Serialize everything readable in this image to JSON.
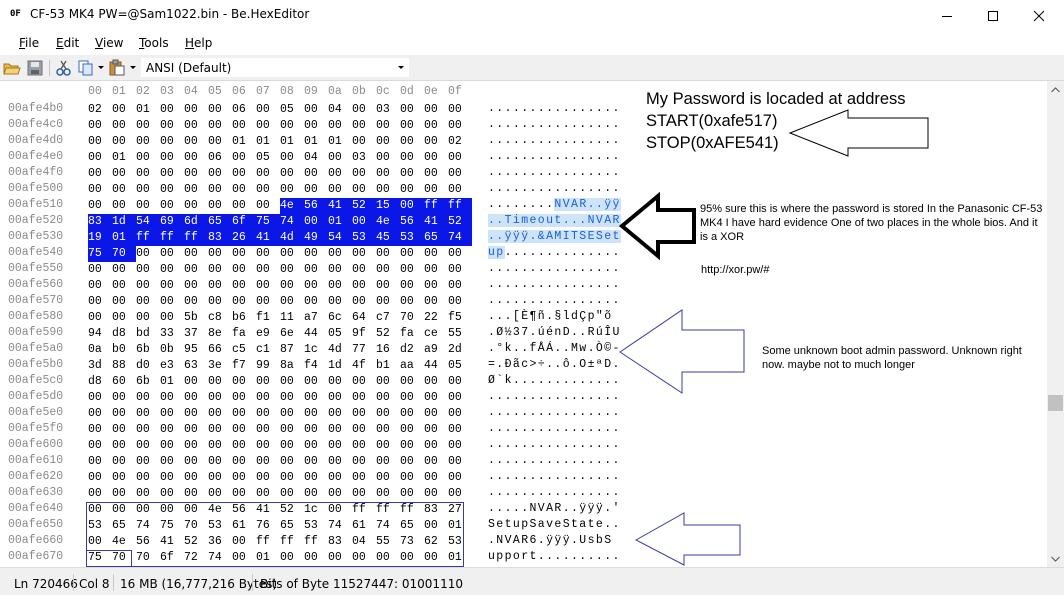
{
  "window": {
    "icon_text": "0F",
    "title": "CF-53 MK4 PW=@Sam1022.bin - Be.HexEditor"
  },
  "menu": [
    {
      "label": "File",
      "key": "F",
      "rest": "ile"
    },
    {
      "label": "Edit",
      "key": "E",
      "rest": "dit"
    },
    {
      "label": "View",
      "key": "V",
      "rest": "iew"
    },
    {
      "label": "Tools",
      "key": "T",
      "rest": "ools"
    },
    {
      "label": "Help",
      "key": "H",
      "rest": "elp"
    }
  ],
  "toolbar": {
    "encoding": "ANSI (Default)"
  },
  "hex": {
    "column_headers": [
      "00",
      "01",
      "02",
      "03",
      "04",
      "05",
      "06",
      "07",
      "08",
      "09",
      "0a",
      "0b",
      "0c",
      "0d",
      "0e",
      "0f"
    ],
    "rows": [
      {
        "offset": "00afe4b0",
        "bytes": [
          "02",
          "00",
          "01",
          "00",
          "00",
          "00",
          "06",
          "00",
          "05",
          "00",
          "04",
          "00",
          "03",
          "00",
          "00",
          "00"
        ],
        "text": "................"
      },
      {
        "offset": "00afe4c0",
        "bytes": [
          "00",
          "00",
          "00",
          "00",
          "00",
          "00",
          "00",
          "00",
          "00",
          "00",
          "00",
          "00",
          "00",
          "00",
          "00",
          "00"
        ],
        "text": "................"
      },
      {
        "offset": "00afe4d0",
        "bytes": [
          "00",
          "00",
          "00",
          "00",
          "00",
          "00",
          "01",
          "01",
          "01",
          "01",
          "01",
          "00",
          "00",
          "00",
          "00",
          "02"
        ],
        "text": "................"
      },
      {
        "offset": "00afe4e0",
        "bytes": [
          "00",
          "01",
          "00",
          "00",
          "00",
          "06",
          "00",
          "05",
          "00",
          "04",
          "00",
          "03",
          "00",
          "00",
          "00",
          "00"
        ],
        "text": "................"
      },
      {
        "offset": "00afe4f0",
        "bytes": [
          "00",
          "00",
          "00",
          "00",
          "00",
          "00",
          "00",
          "00",
          "00",
          "00",
          "00",
          "00",
          "00",
          "00",
          "00",
          "00"
        ],
        "text": "................"
      },
      {
        "offset": "00afe500",
        "bytes": [
          "00",
          "00",
          "00",
          "00",
          "00",
          "00",
          "00",
          "00",
          "00",
          "00",
          "00",
          "00",
          "00",
          "00",
          "00",
          "00"
        ],
        "text": "................"
      },
      {
        "offset": "00afe510",
        "bytes": [
          "00",
          "00",
          "00",
          "00",
          "00",
          "00",
          "00",
          "00",
          "4e",
          "56",
          "41",
          "52",
          "15",
          "00",
          "ff",
          "ff"
        ],
        "text": "........",
        "text_sel": "NVAR..ÿÿ",
        "sel_from": 8
      },
      {
        "offset": "00afe520",
        "bytes": [
          "83",
          "1d",
          "54",
          "69",
          "6d",
          "65",
          "6f",
          "75",
          "74",
          "00",
          "01",
          "00",
          "4e",
          "56",
          "41",
          "52"
        ],
        "text": "",
        "text_sel": "..Timeout...NVAR",
        "sel_from": 0
      },
      {
        "offset": "00afe530",
        "bytes": [
          "19",
          "01",
          "ff",
          "ff",
          "ff",
          "83",
          "26",
          "41",
          "4d",
          "49",
          "54",
          "53",
          "45",
          "53",
          "65",
          "74"
        ],
        "text": "",
        "text_sel": "..ÿÿÿ.&AMITSESet",
        "sel_from": 0
      },
      {
        "offset": "00afe540",
        "bytes": [
          "75",
          "70",
          "00",
          "00",
          "00",
          "00",
          "00",
          "00",
          "00",
          "00",
          "00",
          "00",
          "00",
          "00",
          "00",
          "00"
        ],
        "text_pre": "up",
        "text": "..............",
        "sel_to": 2
      },
      {
        "offset": "00afe550",
        "bytes": [
          "00",
          "00",
          "00",
          "00",
          "00",
          "00",
          "00",
          "00",
          "00",
          "00",
          "00",
          "00",
          "00",
          "00",
          "00",
          "00"
        ],
        "text": "................"
      },
      {
        "offset": "00afe560",
        "bytes": [
          "00",
          "00",
          "00",
          "00",
          "00",
          "00",
          "00",
          "00",
          "00",
          "00",
          "00",
          "00",
          "00",
          "00",
          "00",
          "00"
        ],
        "text": "................"
      },
      {
        "offset": "00afe570",
        "bytes": [
          "00",
          "00",
          "00",
          "00",
          "00",
          "00",
          "00",
          "00",
          "00",
          "00",
          "00",
          "00",
          "00",
          "00",
          "00",
          "00"
        ],
        "text": "................"
      },
      {
        "offset": "00afe580",
        "bytes": [
          "00",
          "00",
          "00",
          "00",
          "5b",
          "c8",
          "b6",
          "f1",
          "11",
          "a7",
          "6c",
          "64",
          "c7",
          "70",
          "22",
          "f5"
        ],
        "text": "...[È¶ñ.§ldÇp\"õ"
      },
      {
        "offset": "00afe590",
        "bytes": [
          "94",
          "d8",
          "bd",
          "33",
          "37",
          "8e",
          "fa",
          "e9",
          "6e",
          "44",
          "05",
          "9f",
          "52",
          "fa",
          "ce",
          "55"
        ],
        "text": ".Ø½37.úénD..RúÎU"
      },
      {
        "offset": "00afe5a0",
        "bytes": [
          "0a",
          "b0",
          "6b",
          "0b",
          "95",
          "66",
          "c5",
          "c1",
          "87",
          "1c",
          "4d",
          "77",
          "16",
          "d2",
          "a9",
          "2d"
        ],
        "text": ".°k..fÅÁ..Mw.Ò©-"
      },
      {
        "offset": "00afe5b0",
        "bytes": [
          "3d",
          "88",
          "d0",
          "e3",
          "63",
          "3e",
          "f7",
          "99",
          "8a",
          "f4",
          "1d",
          "4f",
          "b1",
          "aa",
          "44",
          "05"
        ],
        "text": "=.Ðãc>÷..ô.O±ªD."
      },
      {
        "offset": "00afe5c0",
        "bytes": [
          "d8",
          "60",
          "6b",
          "01",
          "00",
          "00",
          "00",
          "00",
          "00",
          "00",
          "00",
          "00",
          "00",
          "00",
          "00",
          "00"
        ],
        "text": "Ø`k............."
      },
      {
        "offset": "00afe5d0",
        "bytes": [
          "00",
          "00",
          "00",
          "00",
          "00",
          "00",
          "00",
          "00",
          "00",
          "00",
          "00",
          "00",
          "00",
          "00",
          "00",
          "00"
        ],
        "text": "................"
      },
      {
        "offset": "00afe5e0",
        "bytes": [
          "00",
          "00",
          "00",
          "00",
          "00",
          "00",
          "00",
          "00",
          "00",
          "00",
          "00",
          "00",
          "00",
          "00",
          "00",
          "00"
        ],
        "text": "................"
      },
      {
        "offset": "00afe5f0",
        "bytes": [
          "00",
          "00",
          "00",
          "00",
          "00",
          "00",
          "00",
          "00",
          "00",
          "00",
          "00",
          "00",
          "00",
          "00",
          "00",
          "00"
        ],
        "text": "................"
      },
      {
        "offset": "00afe600",
        "bytes": [
          "00",
          "00",
          "00",
          "00",
          "00",
          "00",
          "00",
          "00",
          "00",
          "00",
          "00",
          "00",
          "00",
          "00",
          "00",
          "00"
        ],
        "text": "................"
      },
      {
        "offset": "00afe610",
        "bytes": [
          "00",
          "00",
          "00",
          "00",
          "00",
          "00",
          "00",
          "00",
          "00",
          "00",
          "00",
          "00",
          "00",
          "00",
          "00",
          "00"
        ],
        "text": "................"
      },
      {
        "offset": "00afe620",
        "bytes": [
          "00",
          "00",
          "00",
          "00",
          "00",
          "00",
          "00",
          "00",
          "00",
          "00",
          "00",
          "00",
          "00",
          "00",
          "00",
          "00"
        ],
        "text": "................"
      },
      {
        "offset": "00afe630",
        "bytes": [
          "00",
          "00",
          "00",
          "00",
          "00",
          "00",
          "00",
          "00",
          "00",
          "00",
          "00",
          "00",
          "00",
          "00",
          "00",
          "00"
        ],
        "text": "................"
      },
      {
        "offset": "00afe640",
        "bytes": [
          "00",
          "00",
          "00",
          "00",
          "00",
          "4e",
          "56",
          "41",
          "52",
          "1c",
          "00",
          "ff",
          "ff",
          "ff",
          "83",
          "27"
        ],
        "text": ".....NVAR..ÿÿÿ.'"
      },
      {
        "offset": "00afe650",
        "bytes": [
          "53",
          "65",
          "74",
          "75",
          "70",
          "53",
          "61",
          "76",
          "65",
          "53",
          "74",
          "61",
          "74",
          "65",
          "00",
          "01"
        ],
        "text": "SetupSaveState.."
      },
      {
        "offset": "00afe660",
        "bytes": [
          "00",
          "4e",
          "56",
          "41",
          "52",
          "36",
          "00",
          "ff",
          "ff",
          "ff",
          "83",
          "04",
          "55",
          "73",
          "62",
          "53"
        ],
        "text": ".NVAR6.ÿÿÿ.UsbS"
      },
      {
        "offset": "00afe670",
        "bytes": [
          "75",
          "70",
          "70",
          "6f",
          "72",
          "74",
          "00",
          "01",
          "00",
          "00",
          "00",
          "00",
          "00",
          "00",
          "00",
          "01"
        ],
        "text": "upport.........."
      }
    ]
  },
  "annotations": {
    "password_location": [
      "My Password is locaded at address",
      "START(0xafe517)",
      "STOP(0xAFE541)"
    ],
    "nvar_note": "95% sure this is where the password is stored In the Panasonic CF-53 MK4 I have hard evidence One of two places in the whole bios. And it is a XOR",
    "xor_link": "http://xor.pw/#",
    "unknown_note": "Some unknown boot admin password. Unknown right now. maybe not to much longer"
  },
  "status": {
    "line": "Ln 720466",
    "col": "Col 8",
    "size": "16 MB (16,777,216 Bytes)",
    "bits": "Bits of Byte 11527447: 01001110"
  },
  "colors": {
    "selection": "#0a17e6",
    "text_selection": "#cde3f7",
    "offset_gray": "#8a8a8a"
  }
}
